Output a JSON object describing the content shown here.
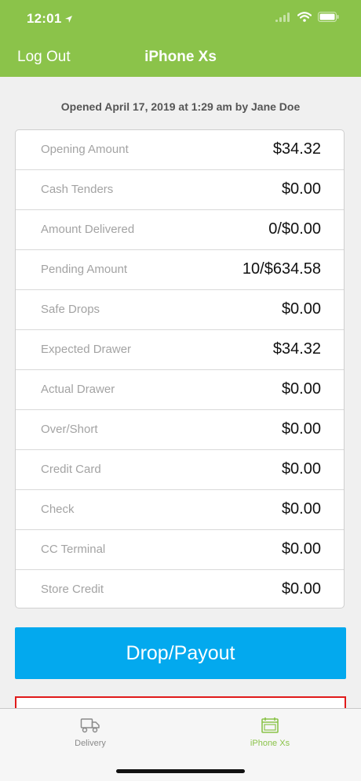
{
  "status_bar": {
    "time": "12:01"
  },
  "nav": {
    "logout_label": "Log Out",
    "title": "iPhone Xs"
  },
  "opened_text": "Opened April 17, 2019 at 1:29 am by Jane Doe",
  "rows": [
    {
      "label": "Opening Amount",
      "value": "$34.32"
    },
    {
      "label": "Cash Tenders",
      "value": "$0.00"
    },
    {
      "label": "Amount Delivered",
      "value": "0/$0.00"
    },
    {
      "label": "Pending Amount",
      "value": "10/$634.58"
    },
    {
      "label": "Safe Drops",
      "value": "$0.00"
    },
    {
      "label": "Expected Drawer",
      "value": "$34.32"
    },
    {
      "label": "Actual Drawer",
      "value": "$0.00"
    },
    {
      "label": "Over/Short",
      "value": "$0.00"
    },
    {
      "label": "Credit Card",
      "value": "$0.00"
    },
    {
      "label": "Check",
      "value": "$0.00"
    },
    {
      "label": "CC Terminal",
      "value": "$0.00"
    },
    {
      "label": "Store Credit",
      "value": "$0.00"
    }
  ],
  "drop_button_label": "Drop/Payout",
  "tabs": [
    {
      "label": "Delivery",
      "icon": "truck-icon",
      "active": false
    },
    {
      "label": "iPhone Xs",
      "icon": "register-icon",
      "active": true
    }
  ],
  "colors": {
    "header": "#8bc34a",
    "button": "#03a9ee",
    "alert_border": "#e01a1a"
  }
}
